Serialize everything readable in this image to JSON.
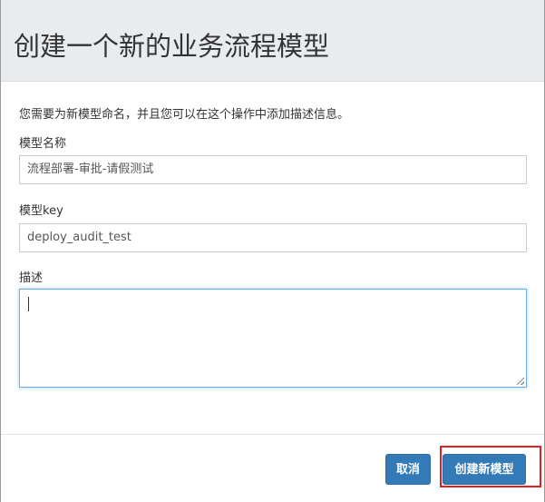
{
  "dialog": {
    "title": "创建一个新的业务流程模型"
  },
  "form": {
    "intro": "您需要为新模型命名，并且您可以在这个操作中添加描述信息。",
    "model_name_label": "模型名称",
    "model_name_value": "流程部署-审批-请假测试",
    "model_key_label": "模型key",
    "model_key_value": "deploy_audit_test",
    "description_label": "描述",
    "description_value": ""
  },
  "footer": {
    "cancel_label": "取消",
    "create_label": "创建新模型"
  },
  "colors": {
    "header_bg": "#e9ecef",
    "primary_button": "#337ab7",
    "focus_border": "#66afe9",
    "highlight": "#e02020"
  }
}
